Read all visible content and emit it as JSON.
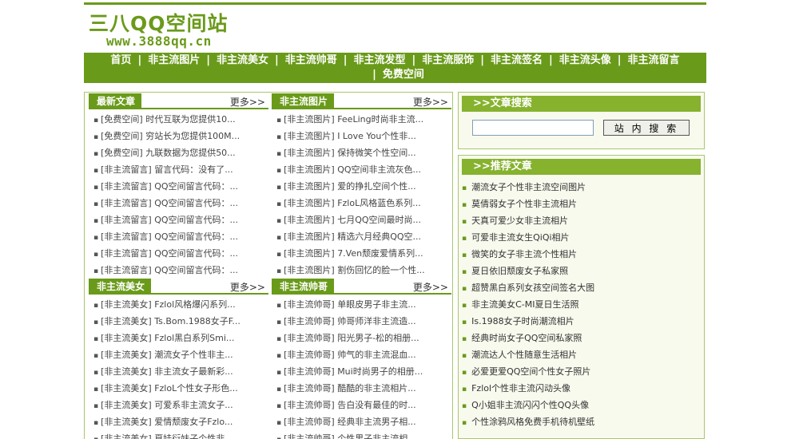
{
  "logo": {
    "title": "三八QQ空间站",
    "url": "www.3888qq.cn"
  },
  "nav": {
    "row1": [
      "首页",
      "非主流图片",
      "非主流美女",
      "非主流帅哥",
      "非主流发型",
      "非主流服饰",
      "非主流签名",
      "非主流头像",
      "非主流留言"
    ],
    "row2": [
      "免费空间"
    ],
    "separator": "|"
  },
  "more_label": "更多>>",
  "bullet": "▪",
  "sections": {
    "latest": {
      "title": "最新文章",
      "items": [
        "[免费空间] 时代互联为您提供10...",
        "[免费空间] 穷站长为您提供100M...",
        "[免费空间] 九联数据为您提供50...",
        "[非主流留言] 留言代码：没有了...",
        "[非主流留言] QQ空间留言代码：...",
        "[非主流留言] QQ空间留言代码：...",
        "[非主流留言] QQ空间留言代码：...",
        "[非主流留言] QQ空间留言代码：...",
        "[非主流留言] QQ空间留言代码：...",
        "[非主流留言] QQ空间留言代码：..."
      ]
    },
    "pictures": {
      "title": "非主流图片",
      "items": [
        "[非主流图片] FeeLing时尚非主流...",
        "[非主流图片] I Love You个性非...",
        "[非主流图片] 保持微笑个性空间...",
        "[非主流图片] QQ空间非主流灰色...",
        "[非主流图片] 爱的挣扎空间个性...",
        "[非主流图片] FzloL风格蓝色系列...",
        "[非主流图片] 七月QQ空间最时尚...",
        "[非主流图片] 精选六月经典QQ空...",
        "[非主流图片] 7.Ven颓废爱情系列...",
        "[非主流图片] 割伤回忆的脸一个性..."
      ]
    },
    "beauty": {
      "title": "非主流美女",
      "items": [
        "[非主流美女] Fzlol风格爆闪系列...",
        "[非主流美女] Ts.Bom.1988女子F...",
        "[非主流美女] Fzlol黑白系列Smi...",
        "[非主流美女] 潮流女子个性非主...",
        "[非主流美女] 非主流女子最新彩...",
        "[非主流美女] FzloL个性女子形色...",
        "[非主流美女] 可爱系非主流女子...",
        "[非主流美女] 爱情颓废女子Fzlo...",
        "[非主流美女] 夏娃衍妹子个性非..."
      ]
    },
    "handsome": {
      "title": "非主流帅哥",
      "items": [
        "[非主流帅哥] 单眼皮男子非主流...",
        "[非主流帅哥] 帅哥师洋非主流造...",
        "[非主流帅哥] 阳光男子-松的相册...",
        "[非主流帅哥] 帅气的非主流混血...",
        "[非主流帅哥] Mui时尚男子的相册...",
        "[非主流帅哥] 酷酷的非主流相片...",
        "[非主流帅哥] 告白没有最佳的时...",
        "[非主流帅哥] 经典非主流男子相...",
        "[非主流帅哥] 个性男子非主流相..."
      ]
    }
  },
  "search": {
    "title": ">>文章搜索",
    "input_value": "",
    "button_label": "站 内 搜 索"
  },
  "recommended": {
    "title": ">>推荐文章",
    "items": [
      "潮流女子个性非主流空间图片",
      "莫倩弱女子个性非主流相片",
      "天真可爱少女非主流相片",
      "可爱非主流女生QiQi相片",
      "微笑的女子非主流个性相片",
      "夏日依旧颓废女子私家照",
      "超赞黑白系列女孩空间签名大图",
      "非主流美女C-MI夏日生活照",
      "Is.1988女子时尚潮流相片",
      "经典时尚女子QQ空间私家照",
      "潮流达人个性随意生活相片",
      "必爱更爱QQ空间个性女子照片",
      "Fzlol个性非主流闪动头像",
      "Q小姐非主流闪闪个性QQ头像",
      "个性涂鸦风格免费手机待机壁纸"
    ]
  },
  "colors": {
    "brand_green": "#6a9a1a",
    "header_green": "#86b22e",
    "border": "#a8c86c"
  }
}
